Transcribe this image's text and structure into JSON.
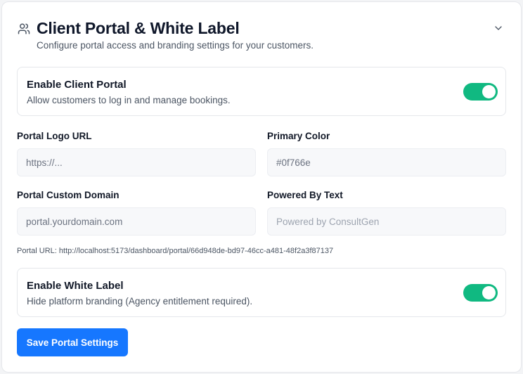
{
  "section": {
    "title": "Client Portal & White Label",
    "subtitle": "Configure portal access and branding settings for your customers.",
    "header_icon": "users-icon",
    "collapse_icon": "chevron-down-icon"
  },
  "client_portal": {
    "title": "Enable Client Portal",
    "description": "Allow customers to log in and manage bookings.",
    "enabled": true
  },
  "fields": {
    "logo_url": {
      "label": "Portal Logo URL",
      "value": "",
      "placeholder": "https://..."
    },
    "primary_color": {
      "label": "Primary Color",
      "value": "",
      "placeholder": "#0f766e"
    },
    "custom_domain": {
      "label": "Portal Custom Domain",
      "value": "",
      "placeholder": "portal.yourdomain.com"
    },
    "powered_by": {
      "label": "Powered By Text",
      "value": "",
      "placeholder": "Powered by ConsultGen"
    }
  },
  "portal_url_text": "Portal URL: http://localhost:5173/dashboard/portal/66d948de-bd97-46cc-a481-48f2a3f87137",
  "white_label": {
    "title": "Enable White Label",
    "description": "Hide platform branding (Agency entitlement required).",
    "enabled": true
  },
  "save_button": {
    "label": "Save Portal Settings"
  },
  "colors": {
    "accent": "#1677ff",
    "toggle_on": "#10b981",
    "card_border": "#e5e7eb",
    "input_bg": "#f7f8fa"
  }
}
